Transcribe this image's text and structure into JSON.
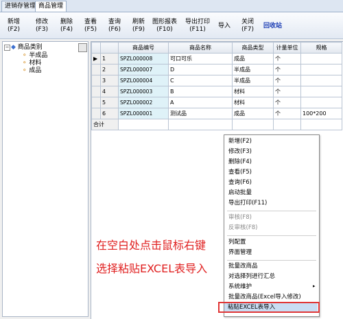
{
  "tabs": [
    {
      "label": "进销存管理"
    },
    {
      "label": "商品管理"
    }
  ],
  "toolbar": [
    {
      "label": "新增",
      "key": "(F2)"
    },
    {
      "label": "修改",
      "key": "(F3)"
    },
    {
      "label": "删除",
      "key": "(F4)"
    },
    {
      "label": "查看",
      "key": "(F5)"
    },
    {
      "label": "查询",
      "key": "(F6)"
    },
    {
      "label": "刷新",
      "key": "(F9)"
    },
    {
      "label": "图形报表",
      "key": "(F10)"
    },
    {
      "label": "导出打印",
      "key": "(F11)"
    },
    {
      "label": "导入",
      "key": ""
    },
    {
      "label": "关闭",
      "key": "(F7)"
    },
    {
      "label": "回收站",
      "key": ""
    }
  ],
  "tree": {
    "root": "商品类别",
    "children": [
      "半成品",
      "材料",
      "成品"
    ]
  },
  "table": {
    "headers": [
      "",
      "",
      "商品编号",
      "商品名称",
      "商品类型",
      "计量单位",
      "规格"
    ],
    "rows": [
      {
        "n": "1",
        "code": "SPZL000008",
        "name": "可口可乐",
        "type": "成品",
        "unit": "个",
        "spec": ""
      },
      {
        "n": "2",
        "code": "SPZL000007",
        "name": "D",
        "type": "半成品",
        "unit": "个",
        "spec": ""
      },
      {
        "n": "3",
        "code": "SPZL000004",
        "name": "C",
        "type": "半成品",
        "unit": "个",
        "spec": ""
      },
      {
        "n": "4",
        "code": "SPZL000003",
        "name": "B",
        "type": "材料",
        "unit": "个",
        "spec": ""
      },
      {
        "n": "5",
        "code": "SPZL000002",
        "name": "A",
        "type": "材料",
        "unit": "个",
        "spec": ""
      },
      {
        "n": "6",
        "code": "SPZL000001",
        "name": "测试品",
        "type": "成品",
        "unit": "个",
        "spec": "100*200"
      }
    ],
    "total_label": "合计",
    "row_pointer": "▶"
  },
  "context_menu": {
    "items": [
      "新增(F2)",
      "修改(F3)",
      "删除(F4)",
      "查看(F5)",
      "查询(F6)",
      "启动批量",
      "导出打印(F11)",
      "审核(F8)",
      "反审核(F8)",
      "列配置",
      "界面管理",
      "批量改商品",
      "对选择列进行汇总",
      "系统维护",
      "批量改商品(Excel导入修改)",
      "粘贴EXCEL表导入"
    ],
    "submenu_arrow": "▸"
  },
  "annotation": {
    "line1": "在空白处点击鼠标右键",
    "line2": "选择粘贴EXCEL表导入"
  },
  "colors": {
    "annotation": "#e02020",
    "highlight_border": "#e03535",
    "link_blue": "#1d3fb5"
  }
}
